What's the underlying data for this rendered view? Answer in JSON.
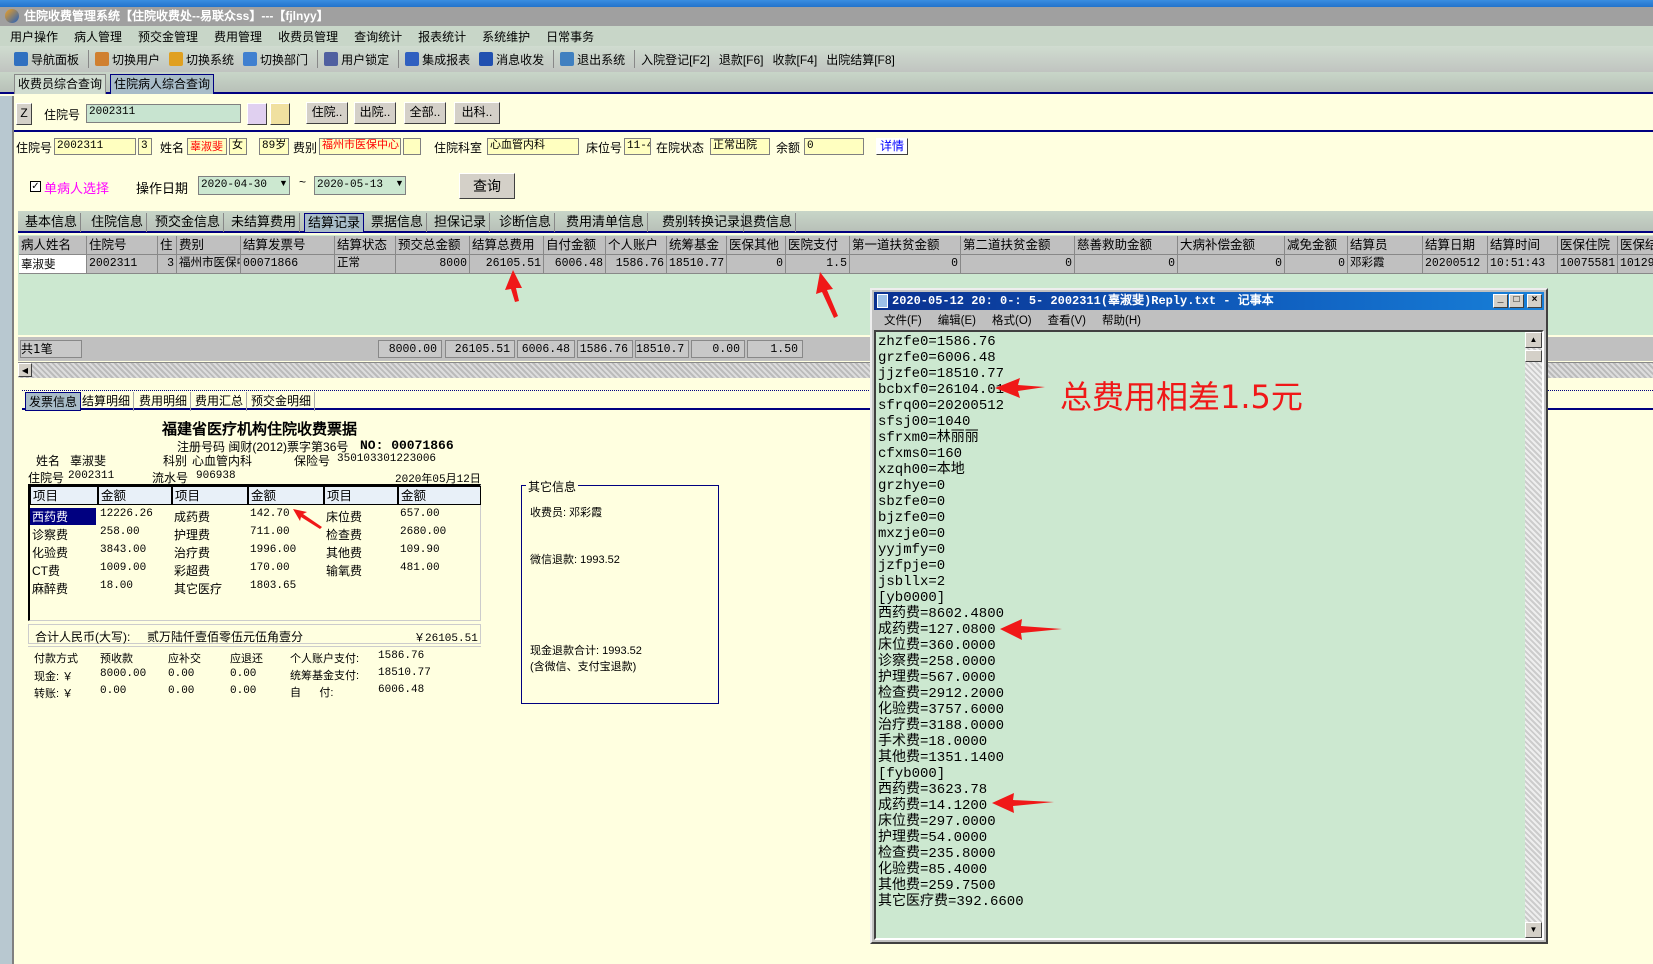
{
  "window": {
    "title": "住院收费管理系统【住院收费处--易联众ss】---【fjlnyy】"
  },
  "menu": [
    "用户操作",
    "病人管理",
    "预交金管理",
    "费用管理",
    "收费员管理",
    "查询统计",
    "报表统计",
    "系统维护",
    "日常事务"
  ],
  "toolbar": [
    {
      "label": "导航面板",
      "icon": "dashboard-icon",
      "color": "#3070c0"
    },
    {
      "label": "切换用户",
      "icon": "switch-user-icon",
      "color": "#d08030"
    },
    {
      "label": "切换系统",
      "icon": "switch-system-icon",
      "color": "#e0a020"
    },
    {
      "label": "切换部门",
      "icon": "switch-department-icon",
      "color": "#4080d0"
    },
    {
      "label": "用户锁定",
      "icon": "lock-user-icon",
      "color": "#5060a0"
    },
    {
      "label": "集成报表",
      "icon": "report-icon",
      "color": "#3060c0"
    },
    {
      "label": "消息收发",
      "icon": "info-icon",
      "color": "#2050b0"
    },
    {
      "label": "退出系统",
      "icon": "exit-icon",
      "color": "#4080c0"
    },
    {
      "label": "入院登记[F2]"
    },
    {
      "label": "退款[F6]"
    },
    {
      "label": "收款[F4]"
    },
    {
      "label": "出院结算[F8]"
    }
  ],
  "app_tabs": [
    "收费员综合查询",
    "住院病人综合查询"
  ],
  "search": {
    "z_label": "Z",
    "id_label": "住院号",
    "id_value": "2002311",
    "buttons": [
      "住院..",
      "出院..",
      "全部..",
      "出科.."
    ]
  },
  "patient": {
    "id_label": "住院号",
    "id": "2002311",
    "times": "3",
    "name_label": "姓名",
    "name": "辜淑斐",
    "sex": "女",
    "age": "89岁",
    "fee_type_label": "费别",
    "fee_type": "福州市医保中心",
    "dept_label": "住院科室",
    "dept": "心血管内科",
    "bed_label": "床位号",
    "bed": "11-4",
    "status_label": "在院状态",
    "status": "正常出院",
    "balance_label": "余额",
    "balance": "0",
    "detail_button": "详情"
  },
  "query": {
    "single_patient": "单病人选择",
    "checked": true,
    "date_label": "操作日期",
    "date_from": "2020-04-30",
    "sep": "~",
    "date_to": "2020-05-13",
    "query_button": "查询"
  },
  "detail_tabs": [
    "基本信息",
    "住院信息",
    "预交金信息",
    "未结算费用",
    "结算记录",
    "票据信息",
    "担保记录",
    "诊断信息",
    "费用清单信息",
    "费别转换记录",
    "退费信息"
  ],
  "grid": {
    "headers": [
      "病人姓名",
      "住院号",
      "住",
      "费别",
      "结算发票号",
      "结算状态",
      "预交总金额",
      "结算总费用",
      "自付金额",
      "个人账户",
      "统筹基金",
      "医保其他",
      "医院支付",
      "第一道扶贫金额",
      "第二道扶贫金额",
      "慈善救助金额",
      "大病补偿金额",
      "减免金额",
      "结算员",
      "结算日期",
      "结算时间",
      "医保住院",
      "医保结"
    ],
    "rows": [
      [
        "辜淑斐",
        "2002311",
        "3",
        "福州市医保中心",
        "00071866",
        "正常",
        "8000",
        "26105.51",
        "6006.48",
        "1586.76",
        "18510.77",
        "0",
        "1.5",
        "0",
        "0",
        "0",
        "0",
        "0",
        "邓彩霞",
        "20200512",
        "10:51:43",
        "10075581",
        "10129"
      ]
    ],
    "count": "共1笔",
    "totals": [
      "8000.00",
      "26105.51",
      "6006.48",
      "1586.76",
      "18510.7",
      "0.00",
      "1.50"
    ]
  },
  "bottom_tabs": [
    "发票信息",
    "结算明细",
    "费用明细",
    "费用汇总",
    "预交金明细"
  ],
  "invoice": {
    "title": "福建省医疗机构住院收费票据",
    "reg": "注册号码 闽财(2012)票字第36号",
    "no": "NO: 00071866",
    "name_label": "姓名",
    "name": "辜淑斐",
    "dept_label": "科别",
    "dept": "心血管内科",
    "ins_label": "保险号",
    "ins": "350103301223006",
    "id_label": "住院号",
    "id": "2002311",
    "serial_label": "流水号",
    "serial": "906938",
    "date": "2020年05月12日",
    "headers": [
      "项目",
      "金额",
      "项目",
      "金额",
      "项目",
      "金额"
    ],
    "rows": [
      [
        "西药费",
        "12226.26",
        "成药费",
        "142.70",
        "床位费",
        "657.00"
      ],
      [
        "诊察费",
        "258.00",
        "护理费",
        "711.00",
        "检查费",
        "2680.00"
      ],
      [
        "化验费",
        "3843.00",
        "治疗费",
        "1996.00",
        "其他费",
        "109.90"
      ],
      [
        "CT费",
        "1009.00",
        "彩超费",
        "170.00",
        "输氧费",
        "481.00"
      ],
      [
        "麻醉费",
        "18.00",
        "其它医疗",
        "1803.65",
        "",
        ""
      ]
    ],
    "total_label": "合计人民币(大写):",
    "total_words": "贰万陆仟壹佰零伍元伍角壹分",
    "total": "￥26105.51",
    "pay_headers": [
      "付款方式",
      "预收款",
      "应补交",
      "应退还"
    ],
    "pay_rows": [
      [
        "现金: ￥",
        "8000.00",
        "0.00",
        "0.00"
      ],
      [
        "转账: ￥",
        "0.00",
        "0.00",
        "0.00"
      ]
    ],
    "side": [
      [
        "个人账户支付:",
        "1586.76"
      ],
      [
        "统筹基金支付:",
        "18510.77"
      ],
      [
        "自      付:",
        "6006.48"
      ]
    ]
  },
  "other_info": {
    "title": "其它信息",
    "cashier": "收费员: 邓彩霞",
    "wechat": "微信退款: 1993.52",
    "cash_total": "现金退款合计: 1993.52",
    "note": "(含微信、支付宝退款)"
  },
  "notepad": {
    "title": "2020-05-12 20: 0-: 5- 2002311(辜淑斐)Reply.txt - 记事本",
    "menu": [
      "文件(F)",
      "编辑(E)",
      "格式(O)",
      "查看(V)",
      "帮助(H)"
    ],
    "lines": [
      "zhzfe0=1586.76",
      "grzfe0=6006.48",
      "jjzfe0=18510.77",
      "bcbxf0=26104.01",
      "sfrq00=20200512",
      "sfsj00=1040",
      "sfrxm0=林丽丽",
      "cfxms0=160",
      "xzqh00=本地",
      "grzhye=0",
      "sbzfe0=0",
      "bjzfe0=0",
      "mxzje0=0",
      "yyjmfy=0",
      "jzfpje=0",
      "jsbllx=2",
      "[yb0000]",
      "西药费=8602.4800",
      "成药费=127.0800",
      "床位费=360.0000",
      "诊察费=258.0000",
      "护理费=567.0000",
      "检查费=2912.2000",
      "化验费=3757.6000",
      "治疗费=3188.0000",
      "手术费=18.0000",
      "其他费=1351.1400",
      "[fyb000]",
      "西药费=3623.78",
      "成药费=14.1200",
      "床位费=297.0000",
      "护理费=54.0000",
      "检查费=235.8000",
      "化验费=85.4000",
      "其他费=259.7500",
      "其它医疗费=392.6600"
    ]
  },
  "annotation": {
    "text": "总费用相差1.5元",
    "color": "#f01818"
  }
}
